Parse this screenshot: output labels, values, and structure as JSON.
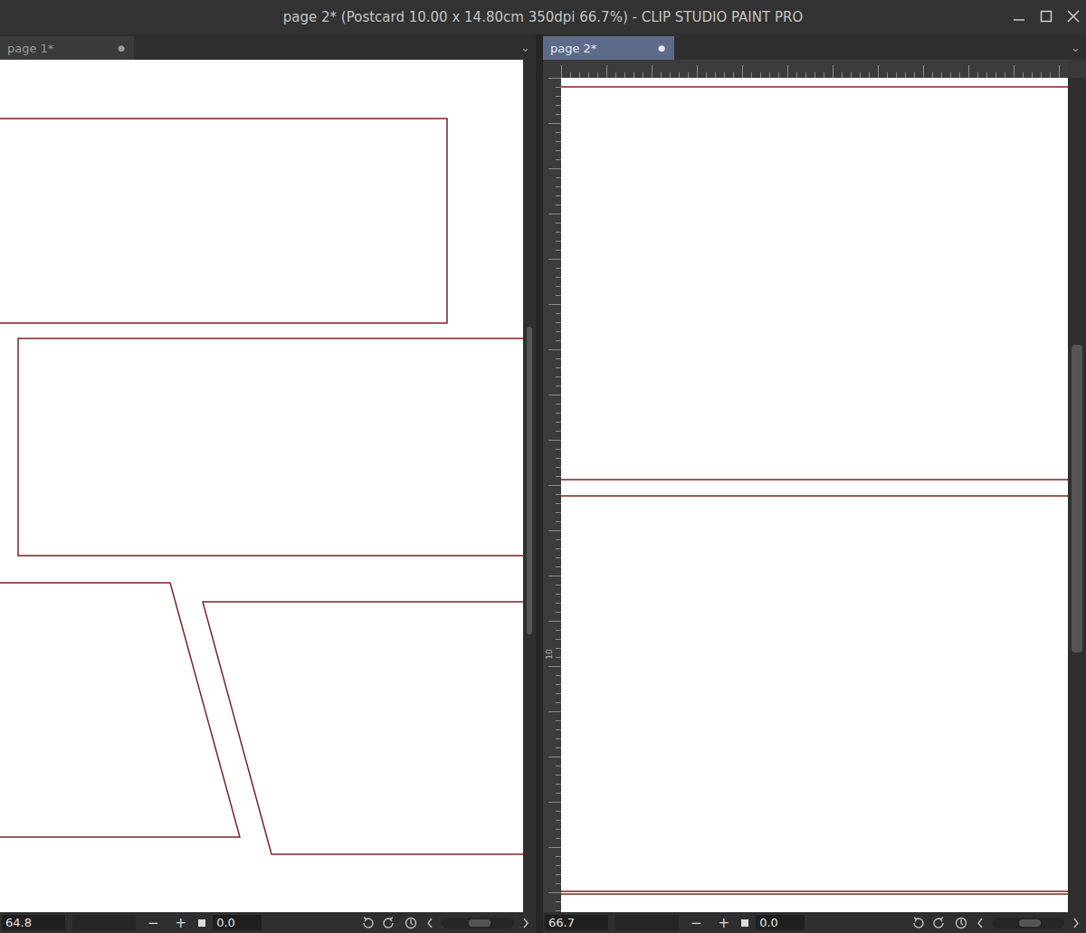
{
  "window": {
    "title": "page 2* (Postcard 10.00 x 14.80cm 350dpi 66.7%) - CLIP STUDIO PAINT PRO"
  },
  "panes": [
    {
      "tab": {
        "label": "page 1*",
        "marker": "●",
        "selected": false
      },
      "menu": "⌄",
      "rulers": false,
      "ruler_label": "",
      "zoom": "64.8",
      "zoom_out": "−",
      "zoom_in": "+",
      "angle": "0.0"
    },
    {
      "tab": {
        "label": "page 2*",
        "marker": "●",
        "selected": true
      },
      "menu": "⌄",
      "rulers": true,
      "ruler_label": "10",
      "zoom": "66.7",
      "zoom_out": "−",
      "zoom_in": "+",
      "angle": "0.0"
    }
  ]
}
